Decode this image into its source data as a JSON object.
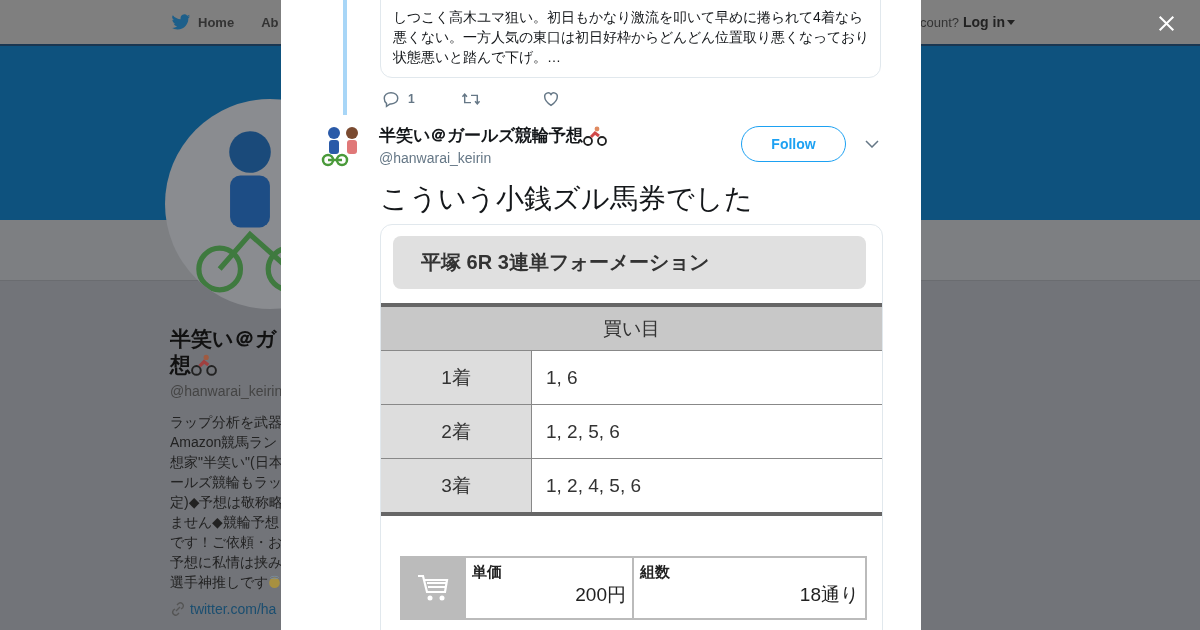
{
  "background_page": {
    "nav": [
      {
        "label": "Home"
      },
      {
        "label": "Ab"
      }
    ],
    "account_prompt": "count?",
    "login": "Log in",
    "profile": {
      "name_lines": [
        "半笑い＠ガ",
        "想"
      ],
      "handle": "@hanwarai_keirin",
      "bio_lines": [
        "ラップ分析を武器",
        "Amazon競馬ラン",
        "想家\"半笑い\"(日本",
        "ールズ競輪もラッ",
        "定)◆予想は敬称略",
        "ません◆競輪予想",
        "です！ご依頼・お",
        "予想に私情は挟み",
        "選手神推しです"
      ],
      "link": "twitter.com/ha"
    }
  },
  "modal": {
    "quoted_tweet": {
      "text": "しつこく高木ユマ狙い。初日もかなり激流を叩いて早めに捲られて4着なら悪くない。一方人気の東口は初日好枠からどんどん位置取り悪くなっており状態悪いと踏んで下げ。…",
      "reply_count": "1"
    },
    "tweet": {
      "name": "半笑い＠ガールズ競輪予想",
      "handle": "@hanwarai_keirin",
      "follow": "Follow",
      "text": "こういう小銭ズル馬券でした",
      "image": {
        "title": "平塚 6R 3連単フォーメーション",
        "header": "買い目",
        "rows": [
          {
            "label": "1着",
            "value": "1, 6"
          },
          {
            "label": "2着",
            "value": "1, 2, 5, 6"
          },
          {
            "label": "3着",
            "value": "1, 2, 4, 5, 6"
          }
        ],
        "summary": [
          {
            "label": "単価",
            "value": "200円"
          },
          {
            "label": "組数",
            "value": "18通り"
          }
        ]
      }
    }
  }
}
